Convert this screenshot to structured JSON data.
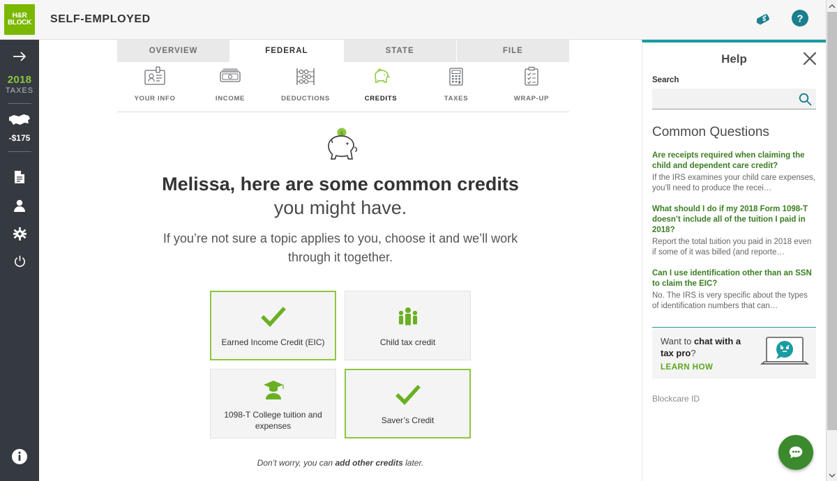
{
  "header": {
    "logo_line1": "H&R",
    "logo_line2": "BLOCK",
    "title": "SELF-EMPLOYED",
    "price_tag_icon": "price-tag-dollar-icon",
    "help_icon": "question-circle-icon"
  },
  "rail": {
    "expand_icon": "arrow-right-icon",
    "year": "2018",
    "year_label": "TAXES",
    "state_icon": "us-map-icon",
    "refund": "-$175",
    "icons": [
      "document-icon",
      "person-icon",
      "gear-icon",
      "power-icon"
    ],
    "info_icon": "info-circle-icon"
  },
  "tabs": [
    {
      "label": "OVERVIEW",
      "active": false
    },
    {
      "label": "FEDERAL",
      "active": true
    },
    {
      "label": "STATE",
      "active": false
    },
    {
      "label": "FILE",
      "active": false
    }
  ],
  "subnav": [
    {
      "label": "YOUR INFO",
      "icon": "id-badge-icon",
      "active": false
    },
    {
      "label": "INCOME",
      "icon": "banknote-icon",
      "active": false
    },
    {
      "label": "DEDUCTIONS",
      "icon": "abacus-icon",
      "active": false
    },
    {
      "label": "CREDITS",
      "icon": "piggy-bank-icon",
      "active": true
    },
    {
      "label": "TAXES",
      "icon": "calculator-icon",
      "active": false
    },
    {
      "label": "WRAP-UP",
      "icon": "clipboard-check-icon",
      "active": false
    }
  ],
  "hero": {
    "icon": "piggy-bank-coin-icon",
    "headline_bold": "Melissa, here are some common credits",
    "headline_rest": " you might have.",
    "subhead": "If you’re not sure a topic applies to you, choose it and we’ll work through it together."
  },
  "cards": [
    {
      "label": "Earned Income Credit (EIC)",
      "icon": "check-icon",
      "selected": true
    },
    {
      "label": "Child tax credit",
      "icon": "family-icon",
      "selected": false
    },
    {
      "label": "1098-T College tuition and expenses",
      "icon": "graduate-icon",
      "selected": false
    },
    {
      "label": "Saver’s Credit",
      "icon": "check-icon",
      "selected": true
    }
  ],
  "footnote": {
    "prefix": "Don’t worry, you can ",
    "bold": "add other credits",
    "suffix": " later."
  },
  "help": {
    "title": "Help",
    "close_icon": "close-icon",
    "search_label": "Search",
    "search_value": "",
    "search_placeholder": "",
    "search_icon": "search-icon",
    "common_questions_title": "Common Questions",
    "faqs": [
      {
        "question": "Are receipts required when claiming the child and dependent care credit?",
        "answer": "If the IRS examines your child care expenses, you’ll need to produce the recei…"
      },
      {
        "question": "What should I do if my 2018 Form 1098-T doesn’t include all of the tuition I paid in 2018?",
        "answer": "Report the total tuition you paid in 2018 even if some of it was billed (and reporte…"
      },
      {
        "question": "Can I use identification other than an SSN to claim the EIC?",
        "answer": "No. The IRS is very specific about the types of identification numbers that can…"
      }
    ],
    "promo": {
      "line1_prefix": "Want to ",
      "line1_bold": "chat with a",
      "line2_bold": "tax pro",
      "line2_suffix": "?",
      "link": "LEARN HOW",
      "art_icon": "laptop-chat-icon"
    },
    "blockcare": "Blockcare ID",
    "fab_icon": "chat-bubble-icon"
  },
  "scrollbar": {
    "up_icon": "chevron-up-icon",
    "down_icon": "chevron-down-icon"
  },
  "colors": {
    "brand_green": "#7ab800",
    "accent_green": "#8cc63e",
    "teal": "#1a7f8e",
    "rail_dark": "#353a40",
    "link_green": "#3b7d23"
  }
}
